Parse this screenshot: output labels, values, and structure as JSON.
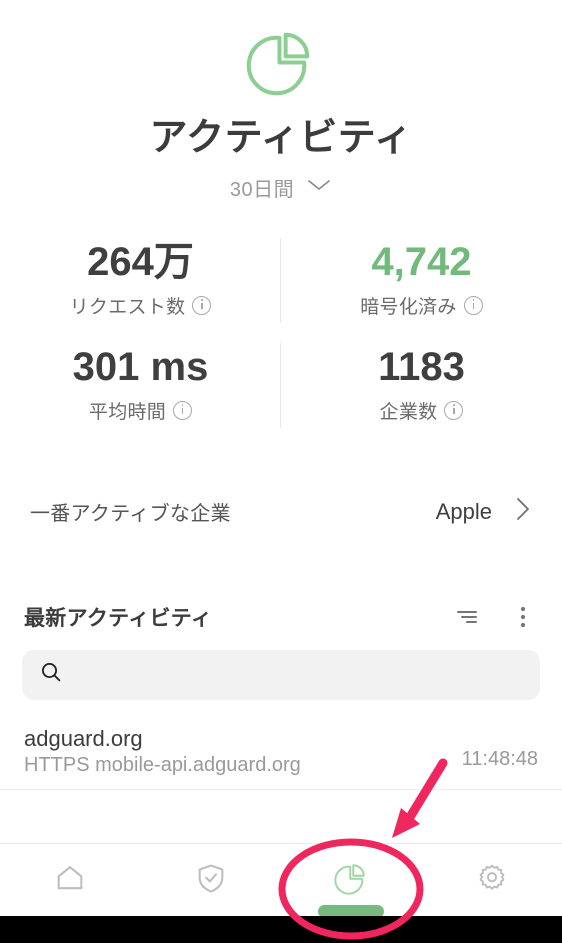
{
  "header": {
    "icon": "pie-chart-icon",
    "title": "アクティビティ",
    "period": "30日間",
    "period_chevron": "chevron-down-icon"
  },
  "stats": [
    {
      "value": "264万",
      "label": "リクエスト数",
      "info": "info-icon",
      "accent": false
    },
    {
      "value": "4,742",
      "label": "暗号化済み",
      "info": "info-icon",
      "accent": true
    },
    {
      "value": "301 ms",
      "label": "平均時間",
      "info": "info-icon",
      "accent": false
    },
    {
      "value": "1183",
      "label": "企業数",
      "info": "info-icon",
      "accent": false
    }
  ],
  "most_active": {
    "label": "一番アクティブな企業",
    "value": "Apple",
    "chevron": "chevron-right-icon"
  },
  "recent": {
    "title": "最新アクティビティ",
    "sort_icon": "sort-filter-icon",
    "more_icon": "more-vertical-icon",
    "search": {
      "icon": "search-icon",
      "value": "",
      "placeholder": ""
    },
    "items": [
      {
        "domain": "adguard.org",
        "detail": "HTTPS mobile-api.adguard.org",
        "time": "11:48:48"
      }
    ]
  },
  "bottom_nav": {
    "items": [
      {
        "icon": "home-icon",
        "active": false
      },
      {
        "icon": "shield-check-icon",
        "active": false
      },
      {
        "icon": "pie-chart-icon",
        "active": true
      },
      {
        "icon": "gear-icon",
        "active": false
      }
    ]
  },
  "annotation": {
    "circle": "highlight-ellipse",
    "arrow": "pointer-arrow",
    "color": "#F0265F"
  },
  "colors": {
    "accent_green": "#72b97c",
    "icon_green": "#8ccf92",
    "text_dark": "#3c3c3c",
    "text_muted": "#9a9a9a",
    "search_bg": "#f2f2f2",
    "annotation_pink": "#F0265F"
  }
}
